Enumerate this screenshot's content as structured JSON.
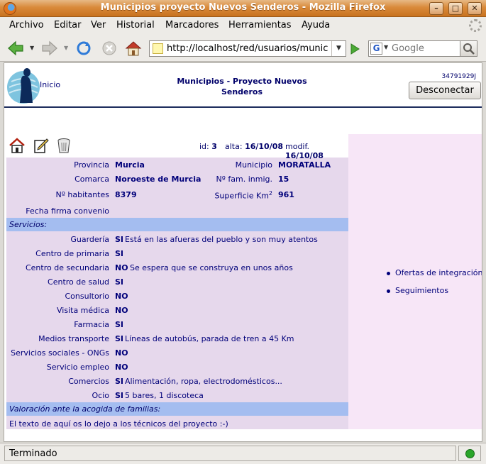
{
  "window": {
    "title": "Municipios proyecto Nuevos Senderos - Mozilla Firefox"
  },
  "menu": [
    "Archivo",
    "Editar",
    "Ver",
    "Historial",
    "Marcadores",
    "Herramientas",
    "Ayuda"
  ],
  "navbar": {
    "url": "http://localhost/red/usuarios/munic",
    "search_placeholder": "Google"
  },
  "page": {
    "inicio": "Inicio",
    "title_line1": "Municipios - Proyecto Nuevos",
    "title_line2": "Senderos",
    "user_id": "34791929J",
    "disconnect": "Desconectar",
    "meta": {
      "id_label": "id:",
      "id_value": "3",
      "alta_label": "alta:",
      "alta_value": "16/10/08",
      "modif_label": "modif.",
      "modif_value": "16/10/08"
    },
    "fields": {
      "provincia_label": "Provincia",
      "provincia": "Murcia",
      "municipio_label": "Municipio",
      "municipio": "MORATALLA",
      "comarca_label": "Comarca",
      "comarca": "Noroeste de Murcia",
      "fam_label": "Nº fam. inmig.",
      "fam": "15",
      "habitantes_label": "Nº habitantes",
      "habitantes": "8379",
      "superficie_label": "Superficie Km",
      "superficie_sup": "2",
      "superficie": "961",
      "fecha_label": "Fecha firma convenio"
    },
    "servicios_title": "Servicios:",
    "servicios": [
      {
        "label": "Guardería",
        "value": "SI",
        "note": "Está en las afueras del pueblo y son muy atentos"
      },
      {
        "label": "Centro de primaria",
        "value": "SI",
        "note": ""
      },
      {
        "label": "Centro de secundaria",
        "value": "NO",
        "note": "Se espera que se construya en unos años"
      },
      {
        "label": "Centro de salud",
        "value": "SI",
        "note": ""
      },
      {
        "label": "Consultorio",
        "value": "NO",
        "note": ""
      },
      {
        "label": "Visita médica",
        "value": "NO",
        "note": ""
      },
      {
        "label": "Farmacia",
        "value": "SI",
        "note": ""
      },
      {
        "label": "Medios transporte",
        "value": "SI",
        "note": "Líneas de autobús, parada de tren a 45 Km"
      },
      {
        "label": "Servicios sociales - ONGs",
        "value": "NO",
        "note": ""
      },
      {
        "label": "Servicio empleo",
        "value": "NO",
        "note": ""
      },
      {
        "label": "Comercios",
        "value": "SI",
        "note": "Alimentación, ropa, electrodomésticos..."
      },
      {
        "label": "Ocio",
        "value": "SI",
        "note": "5 bares, 1 discoteca"
      }
    ],
    "valoracion_title": "Valoración ante la acogida de familias:",
    "valoracion_text": "El texto de aquí os lo dejo a los técnicos del proyecto :-)",
    "sidebar": [
      "Ofertas de integración",
      "Seguimientos"
    ]
  },
  "status": {
    "text": "Terminado"
  },
  "colors": {
    "accent": "#00007a",
    "section": "#a4bdf0",
    "main_bg": "#e6d8ec",
    "sidebar_bg": "#f7e6f7"
  },
  "icons": [
    "firefox-logo-icon",
    "back-icon",
    "forward-icon",
    "reload-icon",
    "stop-icon",
    "home-icon",
    "go-icon",
    "search-icon",
    "house-icon",
    "edit-icon",
    "trash-icon",
    "status-ok-icon"
  ]
}
